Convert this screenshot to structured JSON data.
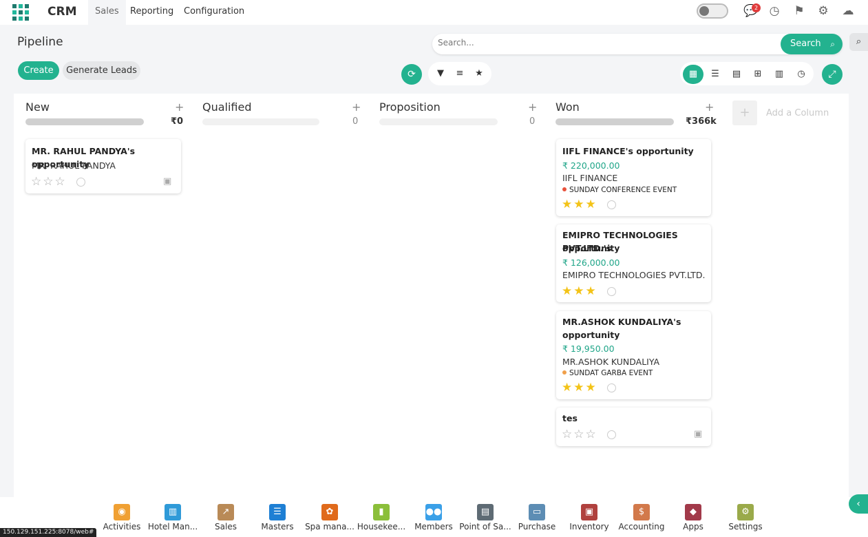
{
  "topbar": {
    "brand": "CRM",
    "menu": [
      "Sales",
      "Reporting",
      "Configuration"
    ],
    "notification_count": "2"
  },
  "control": {
    "title": "Pipeline",
    "create_label": "Create",
    "generate_label": "Generate Leads",
    "search_placeholder": "Search...",
    "search_button": "Search"
  },
  "board": {
    "columns": [
      {
        "name": "New",
        "total": "₹0"
      },
      {
        "name": "Qualified",
        "total": "0"
      },
      {
        "name": "Proposition",
        "total": "0"
      },
      {
        "name": "Won",
        "total": "₹366k"
      }
    ],
    "add_column_label": "Add a Column",
    "cards": [
      {
        "title": "MR. RAHUL PANDYA's opportunity",
        "customer": "MR. RAHUL PANDYA",
        "stars": 0
      },
      {
        "title": "IIFL FINANCE's opportunity",
        "amount": "₹ 220,000.00",
        "customer": "IIFL FINANCE",
        "tag": "SUNDAY CONFERENCE EVENT",
        "tag_color": "#e8513b",
        "stars": 3
      },
      {
        "title_line1": "EMIPRO TECHNOLOGIES PVT.LTD.'s",
        "title_line2": "opportunity",
        "amount": "₹ 126,000.00",
        "customer": "EMIPRO TECHNOLOGIES PVT.LTD.",
        "stars": 3
      },
      {
        "title_line1": "MR.ASHOK KUNDALIYA's",
        "title_line2": "opportunity",
        "amount": "₹ 19,950.00",
        "customer": "MR.ASHOK KUNDALIYA",
        "tag": "SUNDAT GARBA EVENT",
        "tag_color": "#f0a04b",
        "stars": 3
      },
      {
        "title": "tes",
        "stars": 0
      }
    ]
  },
  "dock": [
    {
      "label": "Activities",
      "icon": "activities-icon",
      "color": "#f0a033"
    },
    {
      "label": "Hotel Man...",
      "icon": "hotel-icon",
      "color": "#2f9ad8"
    },
    {
      "label": "Sales",
      "icon": "sales-chart-icon",
      "color": "#b98a57"
    },
    {
      "label": "Masters",
      "icon": "masters-icon",
      "color": "#1e7fd4"
    },
    {
      "label": "Spa mana...",
      "icon": "spa-icon",
      "color": "#e06a1b"
    },
    {
      "label": "Housekee...",
      "icon": "housekeeping-icon",
      "color": "#8bbf3a"
    },
    {
      "label": "Members",
      "icon": "members-icon",
      "color": "#3aa0e8"
    },
    {
      "label": "Point of Sa...",
      "icon": "pos-icon",
      "color": "#5e6b74"
    },
    {
      "label": "Purchase",
      "icon": "purchase-icon",
      "color": "#5d8db4"
    },
    {
      "label": "Inventory",
      "icon": "inventory-icon",
      "color": "#b0413e"
    },
    {
      "label": "Accounting",
      "icon": "accounting-icon",
      "color": "#d2794b"
    },
    {
      "label": "Apps",
      "icon": "apps-icon",
      "color": "#a23a4a"
    },
    {
      "label": "Settings",
      "icon": "settings-icon",
      "color": "#9aaa4a"
    }
  ],
  "status_url": "150.129.151.225:8078/web#"
}
